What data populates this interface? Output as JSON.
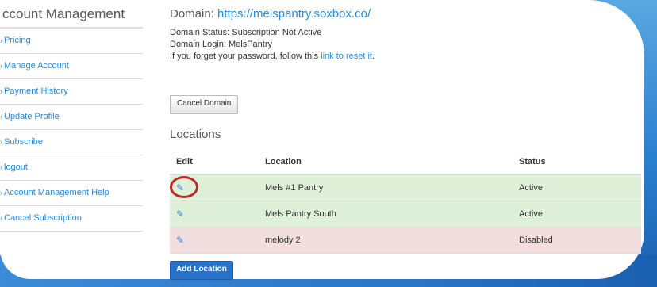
{
  "sidebar": {
    "title": "ccount Management",
    "items": [
      {
        "label": "Pricing"
      },
      {
        "label": "Manage Account"
      },
      {
        "label": "Payment History"
      },
      {
        "label": "Update Profile"
      },
      {
        "label": "Subscribe"
      },
      {
        "label": "logout"
      },
      {
        "label": "Account Management Help"
      },
      {
        "label": "Cancel Subscription"
      }
    ]
  },
  "domain": {
    "prefix": "Domain: ",
    "url": "https://melspantry.soxbox.co/",
    "status_line": "Domain Status: Subscription Not Active",
    "login_line": "Domain Login: MelsPantry",
    "reset_prefix": "If you forget your password, follow this ",
    "reset_link": "link to reset it",
    "reset_suffix": "."
  },
  "cancel_button": "Cancel Domain",
  "locations": {
    "title": "Locations",
    "headers": {
      "edit": "Edit",
      "location": "Location",
      "status": "Status"
    },
    "rows": [
      {
        "name": "Mels #1 Pantry",
        "status": "Active"
      },
      {
        "name": "Mels Pantry South",
        "status": "Active"
      },
      {
        "name": "melody 2",
        "status": "Disabled"
      }
    ]
  },
  "add_button": "Add Location",
  "icons": {
    "edit": "edit-icon",
    "arrow": "chevron-right-icon"
  },
  "colors": {
    "link": "#2a8ad8",
    "active_row": "#dff0d8",
    "disabled_row": "#f2dede",
    "highlight": "#c0272d"
  }
}
